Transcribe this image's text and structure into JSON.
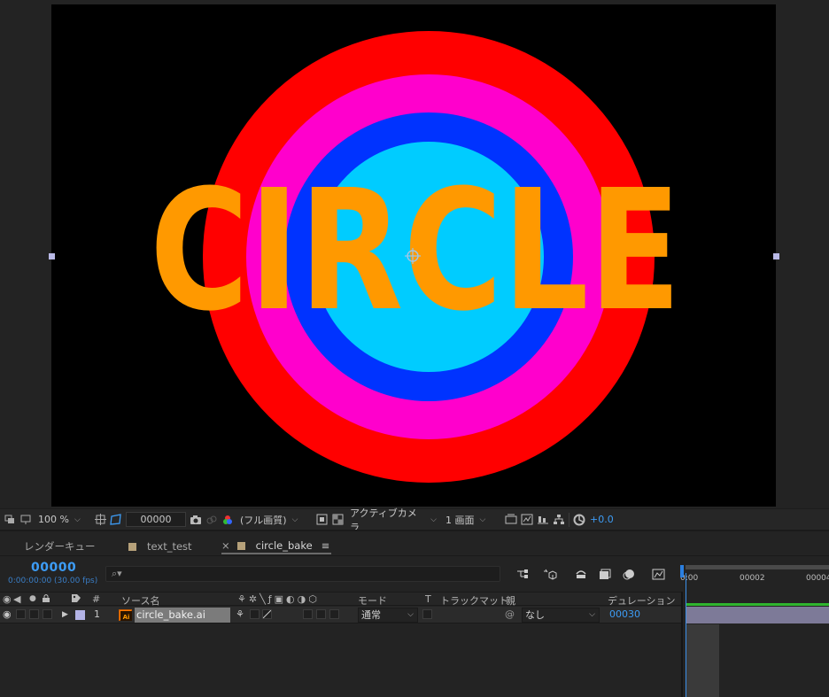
{
  "viewer": {
    "composition_text": "CIRCLE",
    "ring_colors": [
      "#ff0000",
      "#ff00cc",
      "#0033ff",
      "#00ccff"
    ],
    "text_color": "#ff9900"
  },
  "viewer_toolbar": {
    "zoom": "100 %",
    "timecode": "00000",
    "resolution": "(フル画質)",
    "camera": "アクティブカメラ",
    "views": "1 画面",
    "exposure": "+0.0"
  },
  "tabs": [
    {
      "label": "レンダーキュー"
    },
    {
      "label": "text_test"
    },
    {
      "label": "circle_bake",
      "close": "×",
      "menu": "≡"
    }
  ],
  "timeline": {
    "current_time": "00000",
    "current_time_sub": "0:00:00:00 (30.00 fps)",
    "search_icon": "⌕▾",
    "ruler_labels": [
      "0:00",
      "00002",
      "00004"
    ]
  },
  "columns": {
    "num": "#",
    "source_name": "ソース名",
    "mode": "モード",
    "t": "T",
    "track_matte": "トラックマット",
    "parent": "親",
    "duration": "デュレーション"
  },
  "layers": [
    {
      "index": "1",
      "name": "circle_bake.ai",
      "mode": "通常",
      "parent": "なし",
      "duration": "00030",
      "label_color": "#b3b3e6"
    }
  ]
}
